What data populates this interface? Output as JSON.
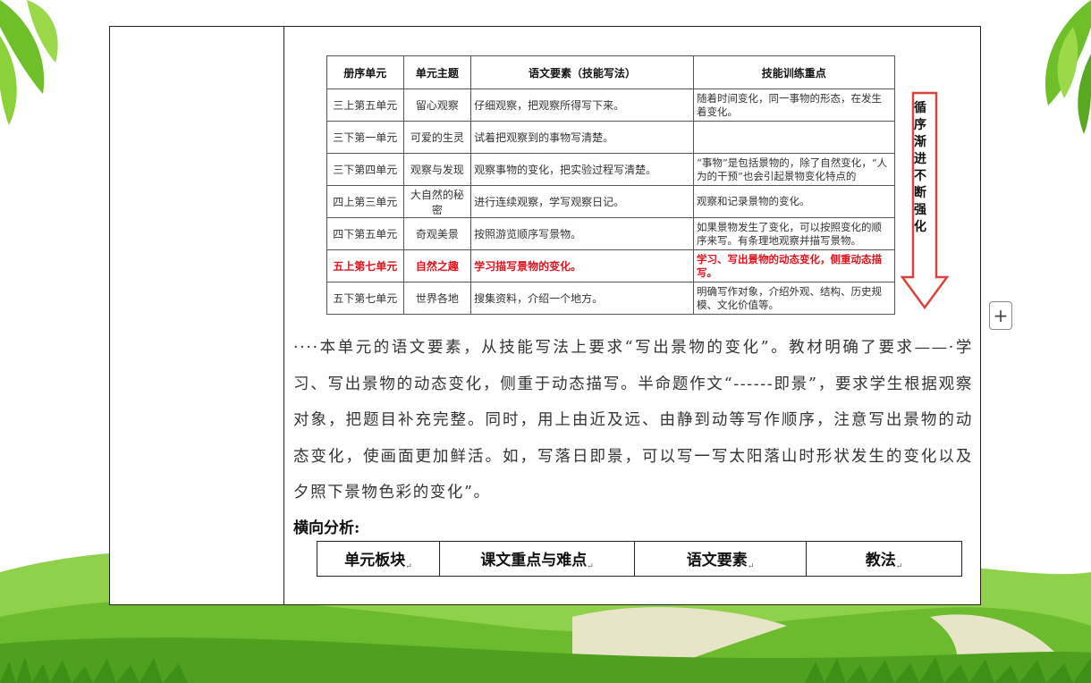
{
  "unit_table": {
    "headers": [
      "册序单元",
      "单元主题",
      "语文要素（技能写法）",
      "技能训练重点"
    ],
    "rows": [
      [
        "三上第五单元",
        "留心观察",
        "仔细观察，把观察所得写下来。",
        "随着时间变化，同一事物的形态，在发生着变化。"
      ],
      [
        "三下第一单元",
        "可爱的生灵",
        "试着把观察到的事物写清楚。",
        ""
      ],
      [
        "三下第四单元",
        "观察与发现",
        "观察事物的变化，把实验过程写清楚。",
        "“事物”是包括景物的，除了自然变化，“人为的干预”也会引起景物变化特点的"
      ],
      [
        "四上第三单元",
        "大自然的秘密",
        "进行连续观察，学写观察日记。",
        "观察和记录景物的变化。"
      ],
      [
        "四下第五单元",
        "奇观美景",
        "按照游览顺序写景物。",
        "如果景物发生了变化，可以按照变化的顺序来写。有条理地观察并描写景物。"
      ],
      [
        "五上第七单元",
        "自然之趣",
        "学习描写景物的变化。",
        "学习、写出景物的动态变化，侧重动态描写。"
      ],
      [
        "五下第七单元",
        "世界各地",
        "搜集资料，介绍一个地方。",
        "明确写作对象，介绍外观、结构、历史规模、文化价值等。"
      ]
    ],
    "highlight_row": 5,
    "arrow_label": "循序渐进 不断强化",
    "highlight_color": "#e0141e"
  },
  "paragraph": "····本单元的语文要素，从技能写法上要求“写出景物的变化”。教材明确了要求——·学习、写出景物的动态变化，侧重于动态描写。半命题作文“------即景”，要求学生根据观察对象，把题目补充完整。同时，用上由近及远、由静到动等写作顺序，注意写出景物的动态变化，使画面更加鲜活。如，写落日即景，可以写一写太阳落山时形状发生的变化以及夕照下景物色彩的变化”。",
  "heading": "横向分析:",
  "bottom_headers": [
    "单元板块",
    "课文重点与难点",
    "语文要素",
    "教法"
  ],
  "toolbar": {
    "add_button_icon": "plus-icon",
    "add_label": "+"
  }
}
